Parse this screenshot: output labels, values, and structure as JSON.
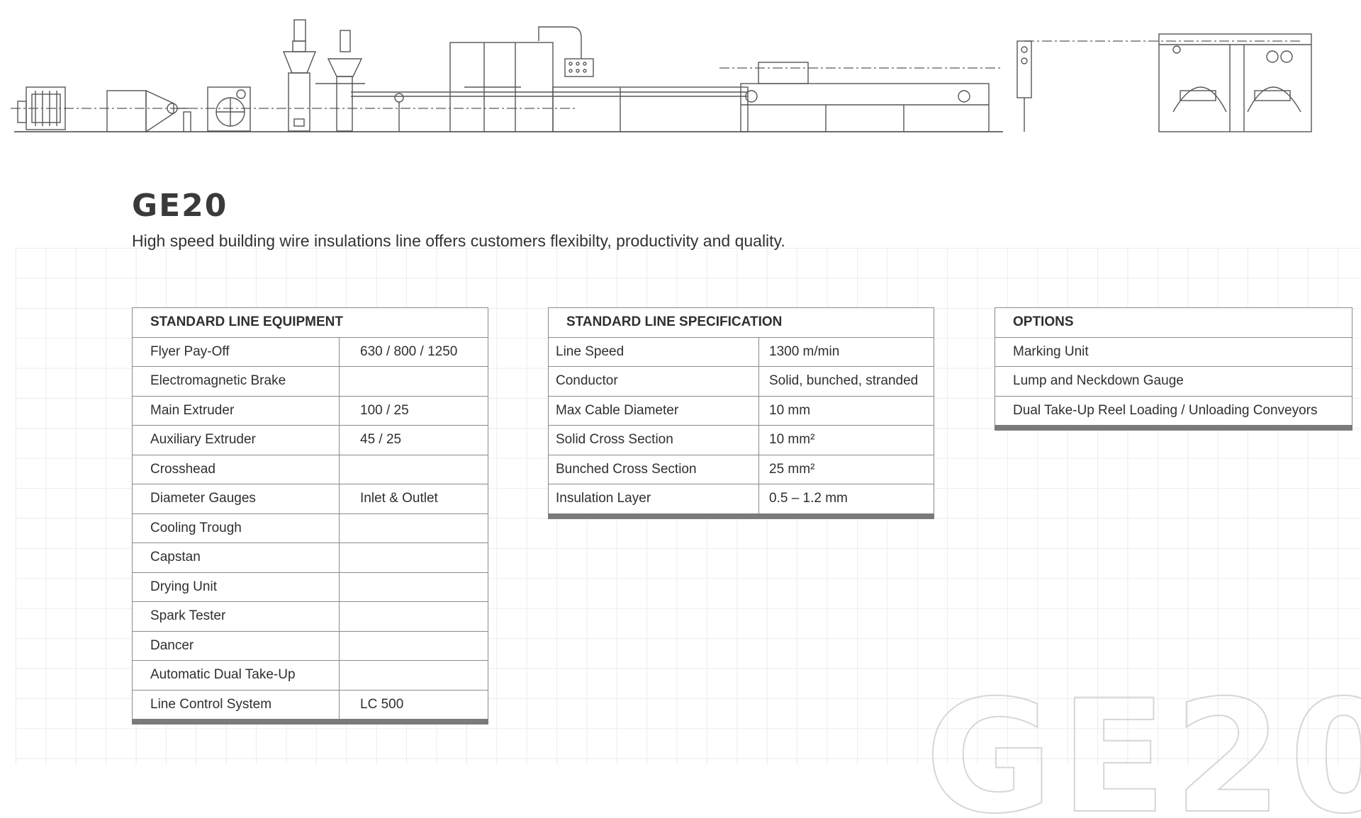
{
  "product": {
    "title": "GE20",
    "subtitle": "High speed building wire insulations line offers customers flexibilty, productivity and quality."
  },
  "watermark_text": "GE20",
  "equipment": {
    "header": "STANDARD LINE EQUIPMENT",
    "rows": [
      {
        "name": "Flyer Pay-Off",
        "value": "630 / 800 / 1250"
      },
      {
        "name": "Electromagnetic Brake",
        "value": ""
      },
      {
        "name": "Main Extruder",
        "value": "100 / 25"
      },
      {
        "name": "Auxiliary Extruder",
        "value": "45 / 25"
      },
      {
        "name": "Crosshead",
        "value": ""
      },
      {
        "name": "Diameter Gauges",
        "value": "Inlet & Outlet"
      },
      {
        "name": "Cooling Trough",
        "value": ""
      },
      {
        "name": "Capstan",
        "value": ""
      },
      {
        "name": "Drying Unit",
        "value": ""
      },
      {
        "name": "Spark Tester",
        "value": ""
      },
      {
        "name": "Dancer",
        "value": ""
      },
      {
        "name": "Automatic Dual Take-Up",
        "value": ""
      },
      {
        "name": "Line Control System",
        "value": "LC 500"
      }
    ]
  },
  "specification": {
    "header": "STANDARD LINE SPECIFICATION",
    "rows": [
      {
        "name": "Line Speed",
        "value": "1300 m/min"
      },
      {
        "name": "Conductor",
        "value": "Solid, bunched, stranded"
      },
      {
        "name": "Max Cable Diameter",
        "value": "10 mm"
      },
      {
        "name": "Solid Cross Section",
        "value": "10 mm²"
      },
      {
        "name": "Bunched Cross Section",
        "value": "25 mm²"
      },
      {
        "name": "Insulation Layer",
        "value": "0.5 – 1.2 mm"
      }
    ]
  },
  "options": {
    "header": "OPTIONS",
    "rows": [
      "Marking Unit",
      "Lump and Neckdown Gauge",
      "Dual Take-Up Reel Loading / Unloading Conveyors"
    ]
  }
}
